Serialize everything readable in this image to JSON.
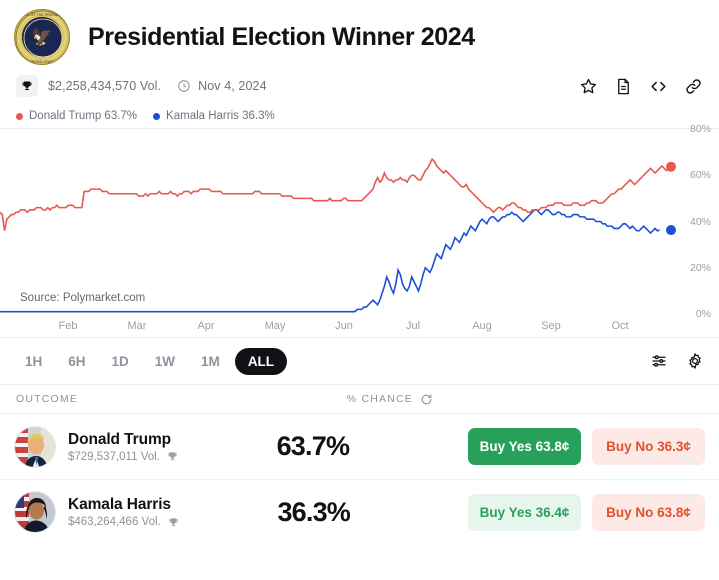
{
  "header": {
    "title": "Presidential Election Winner 2024",
    "logo_icon": "presidential-seal-icon"
  },
  "meta": {
    "trophy_icon": "trophy-icon",
    "volume": "$2,258,434,570 Vol.",
    "clock_icon": "clock-icon",
    "date": "Nov 4, 2024",
    "actions": [
      {
        "name": "bookmark-star-icon",
        "label": "star"
      },
      {
        "name": "document-icon",
        "label": "document"
      },
      {
        "name": "embed-code-icon",
        "label": "code"
      },
      {
        "name": "copy-link-icon",
        "label": "link"
      }
    ]
  },
  "legend": [
    {
      "label": "Donald Trump 63.7%",
      "color": "#e8584f"
    },
    {
      "label": "Kamala Harris 36.3%",
      "color": "#1d4fd8"
    }
  ],
  "chart_watermark": "Source: Polymarket.com",
  "ranges": {
    "options": [
      "1H",
      "6H",
      "1D",
      "1W",
      "1M",
      "ALL"
    ],
    "active": "ALL"
  },
  "chart_tools": [
    {
      "name": "chart-settings-sliders-icon"
    },
    {
      "name": "gear-icon"
    }
  ],
  "table": {
    "header": {
      "outcome": "OUTCOME",
      "chance": "% CHANCE",
      "refresh_icon": "refresh-icon"
    },
    "rows": [
      {
        "avatar": "donald-trump-avatar",
        "name": "Donald Trump",
        "volume": "$729,537,011 Vol.",
        "volume_icon": "trophy-icon",
        "percent": "63.7%",
        "buy_yes": "Buy Yes 63.8¢",
        "buy_no": "Buy No 36.3¢",
        "yes_style": "solid"
      },
      {
        "avatar": "kamala-harris-avatar",
        "name": "Kamala Harris",
        "volume": "$463,264,466 Vol.",
        "volume_icon": "trophy-icon",
        "percent": "36.3%",
        "buy_yes": "Buy Yes 36.4¢",
        "buy_no": "Buy No 63.8¢",
        "yes_style": "soft"
      }
    ]
  },
  "colors": {
    "trump_red": "#e8584f",
    "harris_blue": "#1d4fd8",
    "yes_green": "#27a05a",
    "no_red": "#e1512b",
    "active_pill": "#111215"
  },
  "chart_data": {
    "type": "line",
    "title": "Presidential Election Winner 2024",
    "xlabel": "",
    "ylabel": "% Chance",
    "ylim": [
      0,
      80
    ],
    "yticks": [
      0,
      20,
      40,
      60,
      80
    ],
    "ytick_labels": [
      "0%",
      "20%",
      "40%",
      "60%",
      "80%"
    ],
    "grid": true,
    "legend_position": "top-left",
    "x_tick_labels": [
      "Feb",
      "Mar",
      "Apr",
      "May",
      "Jun",
      "Jul",
      "Aug",
      "Sep",
      "Oct"
    ],
    "series": [
      {
        "name": "Donald Trump",
        "color": "#e8584f",
        "final_value": 63.7,
        "values": [
          44,
          43,
          36,
          41,
          42,
          43,
          43,
          44,
          44,
          45,
          45,
          45,
          44,
          45,
          45,
          45,
          46,
          46,
          46,
          45,
          45,
          46,
          45,
          46,
          46,
          47,
          46,
          46,
          46,
          46,
          47,
          47,
          47,
          46,
          46,
          46,
          46,
          53,
          53,
          53,
          54,
          54,
          54,
          54,
          54,
          53,
          53,
          53,
          52,
          52,
          52,
          52,
          52,
          52,
          52,
          52,
          52,
          52,
          52,
          52,
          52,
          51,
          51,
          51,
          52,
          51,
          52,
          52,
          52,
          52,
          53,
          52,
          52,
          52,
          52,
          53,
          52,
          52,
          51,
          52,
          52,
          53,
          53,
          53,
          52,
          53,
          53,
          53,
          54,
          54,
          54,
          54,
          54,
          53,
          53,
          53,
          53,
          53,
          52,
          52,
          52,
          52,
          52,
          52,
          52,
          52,
          52,
          52,
          52,
          52,
          52,
          52,
          53,
          53,
          53,
          52,
          52,
          52,
          52,
          52,
          52,
          52,
          52,
          52,
          51,
          51,
          51,
          51,
          51,
          50,
          50,
          50,
          50,
          50,
          50,
          50,
          50,
          50,
          49,
          49,
          49,
          49,
          49,
          49,
          49,
          50,
          49,
          49,
          49,
          49,
          49,
          50,
          50,
          49,
          49,
          49,
          49,
          49,
          49,
          49,
          50,
          51,
          52,
          53,
          54,
          57,
          59,
          57,
          58,
          61,
          59,
          58,
          58,
          57,
          58,
          58,
          59,
          58,
          58,
          57,
          59,
          60,
          60,
          59,
          58,
          58,
          60,
          62,
          63,
          65,
          67,
          66,
          64,
          63,
          62,
          61,
          62,
          61,
          60,
          59,
          58,
          57,
          56,
          55,
          55,
          56,
          54,
          53,
          52,
          51,
          50,
          49,
          48,
          47,
          46,
          46,
          45,
          44,
          45,
          46,
          46,
          45,
          46,
          47,
          47,
          48,
          48,
          47,
          46,
          46,
          45,
          45,
          44,
          44,
          45,
          45,
          45,
          45,
          46,
          46,
          46,
          47,
          47,
          47,
          48,
          48,
          48,
          48,
          47,
          47,
          47,
          47,
          48,
          48,
          48,
          47,
          47,
          47,
          48,
          48,
          49,
          49,
          49,
          48,
          48,
          48,
          49,
          50,
          51,
          52,
          52,
          53,
          54,
          54,
          55,
          56,
          57,
          58,
          57,
          56,
          57,
          58,
          59,
          60,
          61,
          62,
          63,
          62,
          61,
          62,
          63,
          64,
          63,
          62,
          63,
          63.7
        ]
      },
      {
        "name": "Kamala Harris",
        "color": "#1d4fd8",
        "final_value": 36.3,
        "values": [
          1,
          1,
          1,
          1,
          1,
          1,
          1,
          1,
          1,
          1,
          1,
          1,
          1,
          1,
          1,
          1,
          1,
          1,
          1,
          1,
          1,
          1,
          1,
          1,
          1,
          1,
          1,
          1,
          1,
          1,
          1,
          1,
          1,
          1,
          1,
          1,
          1,
          1,
          1,
          1,
          1,
          1,
          1,
          1,
          1,
          1,
          1,
          1,
          1,
          1,
          1,
          1,
          1,
          1,
          1,
          1,
          1,
          1,
          1,
          1,
          1,
          1,
          1,
          1,
          1,
          1,
          1,
          1,
          1,
          1,
          1,
          1,
          1,
          1,
          1,
          1,
          1,
          1,
          1,
          1,
          1,
          1,
          1,
          1,
          1,
          1,
          1,
          1,
          1,
          1,
          1,
          1,
          1,
          1,
          1,
          1,
          1,
          1,
          1,
          1,
          1,
          1,
          1,
          1,
          1,
          1,
          1,
          1,
          1,
          1,
          1,
          1,
          1,
          1,
          1,
          1,
          1,
          1,
          1,
          1,
          1,
          1,
          1,
          1,
          1,
          1,
          1,
          1,
          1,
          1,
          1,
          1,
          1,
          1,
          1,
          1,
          1,
          1,
          1,
          1,
          1,
          1,
          1,
          1,
          1,
          1,
          1,
          1,
          1,
          1,
          1,
          1,
          1,
          1,
          1,
          1,
          1,
          2,
          2,
          2,
          3,
          3,
          4,
          5,
          6,
          5,
          4,
          6,
          9,
          12,
          16,
          14,
          11,
          9,
          13,
          19,
          17,
          13,
          11,
          10,
          12,
          16,
          14,
          12,
          10,
          13,
          17,
          20,
          19,
          18,
          20,
          23,
          26,
          25,
          24,
          27,
          30,
          29,
          28,
          30,
          33,
          32,
          31,
          33,
          35,
          34,
          36,
          38,
          37,
          36,
          38,
          40,
          41,
          40,
          39,
          41,
          42,
          42,
          41,
          40,
          41,
          42,
          42,
          43,
          43,
          44,
          43,
          43,
          42,
          41,
          40,
          41,
          42,
          43,
          44,
          45,
          45,
          44,
          43,
          44,
          45,
          45,
          44,
          43,
          43,
          44,
          44,
          43,
          43,
          42,
          42,
          42,
          43,
          43,
          43,
          42,
          42,
          42,
          41,
          41,
          41,
          41,
          40,
          40,
          40,
          39,
          39,
          38,
          38,
          38,
          37,
          37,
          37,
          38,
          39,
          39,
          38,
          37,
          38,
          37,
          36,
          36,
          37,
          38,
          37,
          36,
          35,
          36,
          37,
          36,
          36.3
        ]
      }
    ]
  }
}
